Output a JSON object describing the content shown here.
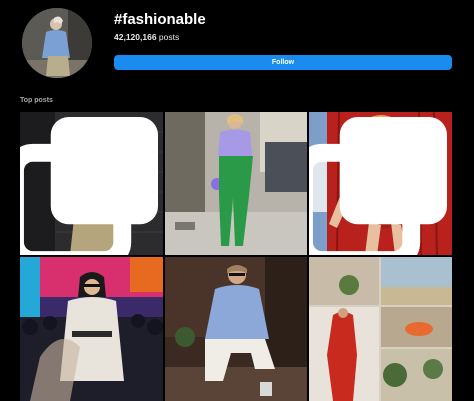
{
  "header": {
    "hashtag": "#fashionable",
    "post_count": "42,120,166",
    "post_suffix": " posts",
    "follow_label": "Follow"
  },
  "section": {
    "label": "Top posts"
  },
  "colors": {
    "background": "#000000",
    "follow_button": "#1a8cf0",
    "muted_text": "#a8a8a8"
  },
  "posts": [
    {
      "id": "post-1",
      "multi": true
    },
    {
      "id": "post-2",
      "multi": false
    },
    {
      "id": "post-3",
      "multi": true
    },
    {
      "id": "post-4",
      "multi": false
    },
    {
      "id": "post-5",
      "multi": false
    },
    {
      "id": "post-6",
      "multi": false
    }
  ],
  "icons": {
    "multi_post": "carousel-icon"
  }
}
